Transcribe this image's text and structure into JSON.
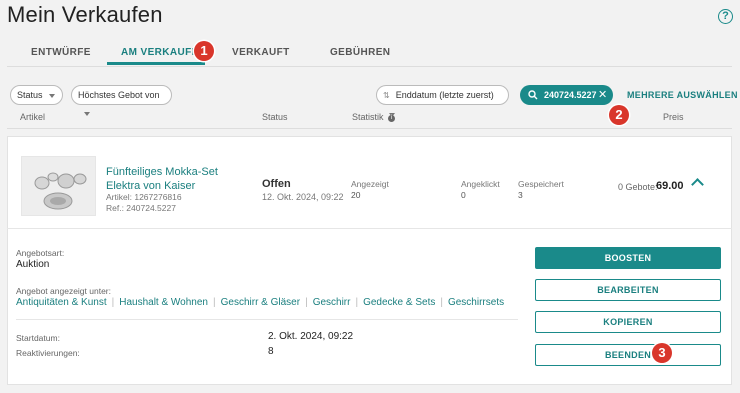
{
  "page": {
    "title": "Mein Verkaufen"
  },
  "tabs": [
    {
      "label": "ENTWÜRFE"
    },
    {
      "label": "AM VERKAUFEN",
      "active": true
    },
    {
      "label": "VERKAUFT"
    },
    {
      "label": "GEBÜHREN"
    }
  ],
  "badges": [
    "1",
    "2",
    "3"
  ],
  "filters": {
    "status": "Status",
    "sort_bid": "Höchstes Gebot von",
    "sort_date": "Enddatum (letzte zuerst)",
    "search_value": "240724.5227",
    "more_select": "MEHRERE AUSWÄHLEN"
  },
  "columns": {
    "artikel": "Artikel",
    "status": "Status",
    "statistik": "Statistik",
    "preis": "Preis"
  },
  "listing": {
    "title": "Fünfteiliges Mokka-Set Elektra von Kaiser",
    "article_no": "Artikel: 1267276816",
    "ref": "Ref.: 240724.5227",
    "status": "Offen",
    "status_date": "12. Okt. 2024, 09:22",
    "stats": {
      "shown_label": "Angezeigt",
      "shown_value": "20",
      "clicked_label": "Angeklickt",
      "clicked_value": "0",
      "saved_label": "Gespeichert",
      "saved_value": "3"
    },
    "bids": "0 Gebote:",
    "price": "69.00"
  },
  "details": {
    "type_label": "Angebotsart:",
    "type_value": "Auktion",
    "categories_label": "Angebot angezeigt unter:",
    "categories": [
      "Antiquitäten & Kunst",
      "Haushalt & Wohnen",
      "Geschirr & Gläser",
      "Geschirr",
      "Gedecke & Sets",
      "Geschirrsets"
    ],
    "start_label": "Startdatum:",
    "start_value": "2. Okt. 2024, 09:22",
    "reactivations_label": "Reaktivierungen:",
    "reactivations_value": "8"
  },
  "actions": {
    "boost": "BOOSTEN",
    "edit": "BEARBEITEN",
    "copy": "KOPIEREN",
    "end": "BEENDEN"
  },
  "colors": {
    "accent": "#1a8a8a",
    "badge": "#d9362b"
  }
}
